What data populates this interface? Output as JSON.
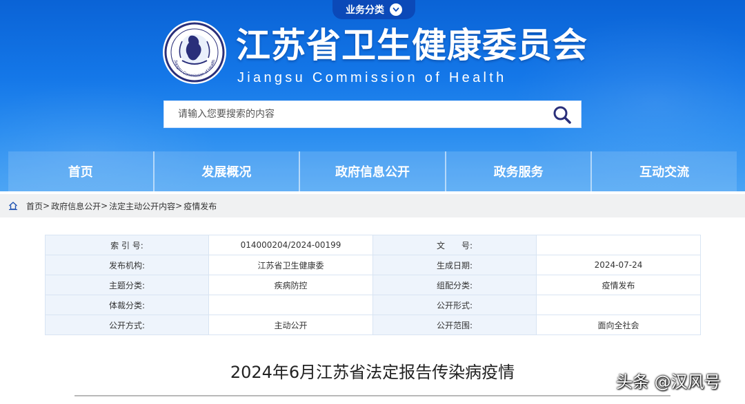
{
  "header": {
    "business_tab": "业务分类",
    "site_title_cn": "江苏省卫生健康委员会",
    "site_title_en": "Jiangsu Commission of Health",
    "emblem_text": "Jiangsu Commission of Health",
    "search_placeholder": "请输入您要搜索的内容"
  },
  "nav": [
    "首页",
    "发展概况",
    "政府信息公开",
    "政务服务",
    "互动交流"
  ],
  "breadcrumb": {
    "items": [
      "首页",
      "政府信息公开",
      "法定主动公开内容",
      "疫情发布"
    ],
    "separator": ">"
  },
  "meta": {
    "rows": [
      [
        {
          "label": "索 引 号:",
          "value": "014000204/2024-00199"
        },
        {
          "label": "文　　号:",
          "value": ""
        }
      ],
      [
        {
          "label": "发布机构:",
          "value": "江苏省卫生健康委"
        },
        {
          "label": "生成日期:",
          "value": "2024-07-24"
        }
      ],
      [
        {
          "label": "主题分类:",
          "value": "疾病防控"
        },
        {
          "label": "组配分类:",
          "value": "疫情发布"
        }
      ],
      [
        {
          "label": "体裁分类:",
          "value": ""
        },
        {
          "label": "公开形式:",
          "value": ""
        }
      ],
      [
        {
          "label": "公开方式:",
          "value": "主动公开"
        },
        {
          "label": "公开范围:",
          "value": "面向全社会"
        }
      ]
    ]
  },
  "article": {
    "title": "2024年6月江苏省法定报告传染病疫情"
  },
  "watermark": "头条 @汉风号",
  "colors": {
    "header_blue": "#1477e8",
    "tab_blue": "#0b49b8",
    "icon_navy": "#2a2f7a",
    "table_label_bg": "#eef4fc"
  },
  "icons": {
    "business_tab": "chevron-down-icon",
    "search": "search-icon",
    "breadcrumb": "home-icon"
  }
}
